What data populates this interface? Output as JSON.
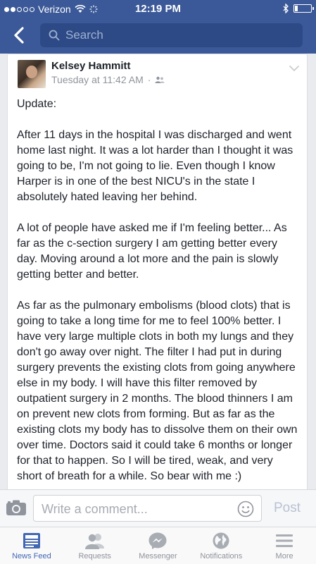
{
  "status_bar": {
    "carrier": "Verizon",
    "time": "12:19 PM"
  },
  "search": {
    "placeholder": "Search"
  },
  "post": {
    "author": "Kelsey Hammitt",
    "timestamp": "Tuesday at 11:42 AM",
    "separator": "·",
    "body": "Update:\n\nAfter 11 days in the hospital I was discharged and went home last night. It was a lot harder than I thought it was going to be, I'm not going to lie. Even though I know Harper is in one of the best NICU's in the state I absolutely hated leaving her behind.\n\nA lot of people have asked me if I'm feeling better... As far as the c-section surgery I am getting better every day. Moving around a lot more and the pain is slowly getting better and better.\n\nAs far as the pulmonary embolisms (blood clots) that is going to take a long time for me to feel 100% better. I have very large multiple clots in both my lungs and they don't go away over night. The filter I had put in during surgery prevents the existing clots from going anywhere else in my body. I will have this filter removed by outpatient surgery in 2 months. The blood thinners I am on prevent new clots from forming. But as far as the existing clots my body has to dissolve them on their own over time. Doctors said it could take 6 months or longer for that to happen. So I will be tired, weak, and very short of breath for a while. So bear with me :)"
  },
  "composer": {
    "placeholder": "Write a comment...",
    "post_label": "Post"
  },
  "tabs": [
    {
      "label": "News Feed",
      "icon": "news-feed-icon",
      "active": true
    },
    {
      "label": "Requests",
      "icon": "friends-icon",
      "active": false
    },
    {
      "label": "Messenger",
      "icon": "messenger-icon",
      "active": false
    },
    {
      "label": "Notifications",
      "icon": "globe-icon",
      "active": false
    },
    {
      "label": "More",
      "icon": "menu-icon",
      "active": false
    }
  ],
  "colors": {
    "brand": "#3b5998",
    "active_tab": "#4267b2"
  }
}
